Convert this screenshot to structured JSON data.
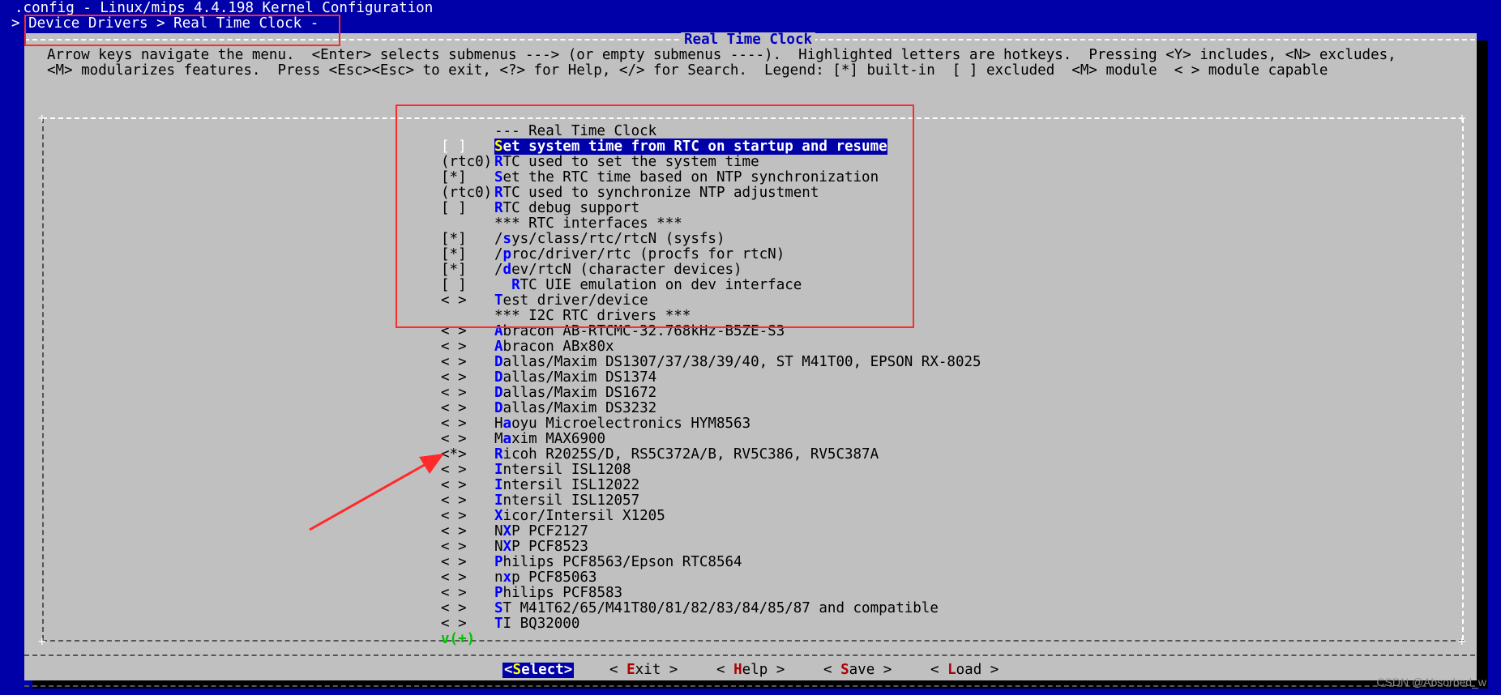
{
  "window": {
    "title": ".config - Linux/mips 4.4.198 Kernel Configuration",
    "breadcrumb": "> Device Drivers > Real Time Clock -"
  },
  "dialog": {
    "title": "Real Time Clock",
    "help_line_1": "Arrow keys navigate the menu.  <Enter> selects submenus ---> (or empty submenus ----).  Highlighted letters are hotkeys.  Pressing <Y> includes, <N> excludes,",
    "help_line_2": "<M> modularizes features.  Press <Esc><Esc> to exit, <?> for Help, </> for Search.  Legend: [*] built-in  [ ] excluded  <M> module  < > module capable"
  },
  "menu": {
    "items": [
      {
        "prefix": "",
        "pre": "--- Real Time Clock",
        "hk": "",
        "post": ""
      },
      {
        "prefix": "[ ]",
        "pre": "",
        "hk": "S",
        "post": "et system time from RTC on startup and resume",
        "selected": true
      },
      {
        "prefix": "(rtc0)",
        "pre": "",
        "hk": "R",
        "post": "TC used to set the system time"
      },
      {
        "prefix": "[*]",
        "pre": "",
        "hk": "S",
        "post": "et the RTC time based on NTP synchronization"
      },
      {
        "prefix": "(rtc0)",
        "pre": "",
        "hk": "R",
        "post": "TC used to synchronize NTP adjustment"
      },
      {
        "prefix": "[ ]",
        "pre": "",
        "hk": "R",
        "post": "TC debug support"
      },
      {
        "prefix": "",
        "pre": "*** RTC interfaces ***",
        "hk": "",
        "post": ""
      },
      {
        "prefix": "[*]",
        "pre": "/",
        "hk": "s",
        "post": "ys/class/rtc/rtcN (sysfs)"
      },
      {
        "prefix": "[*]",
        "pre": "/",
        "hk": "p",
        "post": "roc/driver/rtc (procfs for rtcN)"
      },
      {
        "prefix": "[*]",
        "pre": "/",
        "hk": "d",
        "post": "ev/rtcN (character devices)"
      },
      {
        "prefix": "[ ]",
        "pre": "  ",
        "hk": "R",
        "post": "TC UIE emulation on dev interface"
      },
      {
        "prefix": "< >",
        "pre": "",
        "hk": "T",
        "post": "est driver/device"
      },
      {
        "prefix": "",
        "pre": "*** I2C RTC drivers ***",
        "hk": "",
        "post": ""
      },
      {
        "prefix": "< >",
        "pre": "",
        "hk": "A",
        "post": "bracon AB-RTCMC-32.768kHz-B5ZE-S3"
      },
      {
        "prefix": "< >",
        "pre": "",
        "hk": "A",
        "post": "bracon ABx80x"
      },
      {
        "prefix": "< >",
        "pre": "",
        "hk": "D",
        "post": "allas/Maxim DS1307/37/38/39/40, ST M41T00, EPSON RX-8025"
      },
      {
        "prefix": "< >",
        "pre": "",
        "hk": "D",
        "post": "allas/Maxim DS1374"
      },
      {
        "prefix": "< >",
        "pre": "",
        "hk": "D",
        "post": "allas/Maxim DS1672"
      },
      {
        "prefix": "< >",
        "pre": "",
        "hk": "D",
        "post": "allas/Maxim DS3232"
      },
      {
        "prefix": "< >",
        "pre": "H",
        "hk": "a",
        "post": "oyu Microelectronics HYM8563"
      },
      {
        "prefix": "< >",
        "pre": "M",
        "hk": "a",
        "post": "xim MAX6900"
      },
      {
        "prefix": "<*>",
        "pre": "",
        "hk": "R",
        "post": "icoh R2025S/D, RS5C372A/B, RV5C386, RV5C387A"
      },
      {
        "prefix": "< >",
        "pre": "",
        "hk": "I",
        "post": "ntersil ISL1208"
      },
      {
        "prefix": "< >",
        "pre": "",
        "hk": "I",
        "post": "ntersil ISL12022"
      },
      {
        "prefix": "< >",
        "pre": "",
        "hk": "I",
        "post": "ntersil ISL12057"
      },
      {
        "prefix": "< >",
        "pre": "",
        "hk": "X",
        "post": "icor/Intersil X1205"
      },
      {
        "prefix": "< >",
        "pre": "N",
        "hk": "X",
        "post": "P PCF2127"
      },
      {
        "prefix": "< >",
        "pre": "N",
        "hk": "X",
        "post": "P PCF8523"
      },
      {
        "prefix": "< >",
        "pre": "",
        "hk": "P",
        "post": "hilips PCF8563/Epson RTC8564"
      },
      {
        "prefix": "< >",
        "pre": "n",
        "hk": "x",
        "post": "p PCF85063"
      },
      {
        "prefix": "< >",
        "pre": "",
        "hk": "P",
        "post": "hilips PCF8583"
      },
      {
        "prefix": "< >",
        "pre": "",
        "hk": "S",
        "post": "T M41T62/65/M41T80/81/82/83/84/85/87 and compatible"
      },
      {
        "prefix": "< >",
        "pre": "",
        "hk": "T",
        "post": "I BQ32000"
      }
    ],
    "more_indicator": "v(+)"
  },
  "buttons": [
    {
      "pre": "<",
      "hk": "S",
      "post": "elect>",
      "active": true
    },
    {
      "pre": "< ",
      "hk": "E",
      "post": "xit >"
    },
    {
      "pre": "< ",
      "hk": "H",
      "post": "elp >"
    },
    {
      "pre": "< ",
      "hk": "S",
      "post": "ave >"
    },
    {
      "pre": "< ",
      "hk": "L",
      "post": "oad >"
    }
  ],
  "watermark": "CSDN @Absorbed_w",
  "annotation_color": "#ff2a2a"
}
